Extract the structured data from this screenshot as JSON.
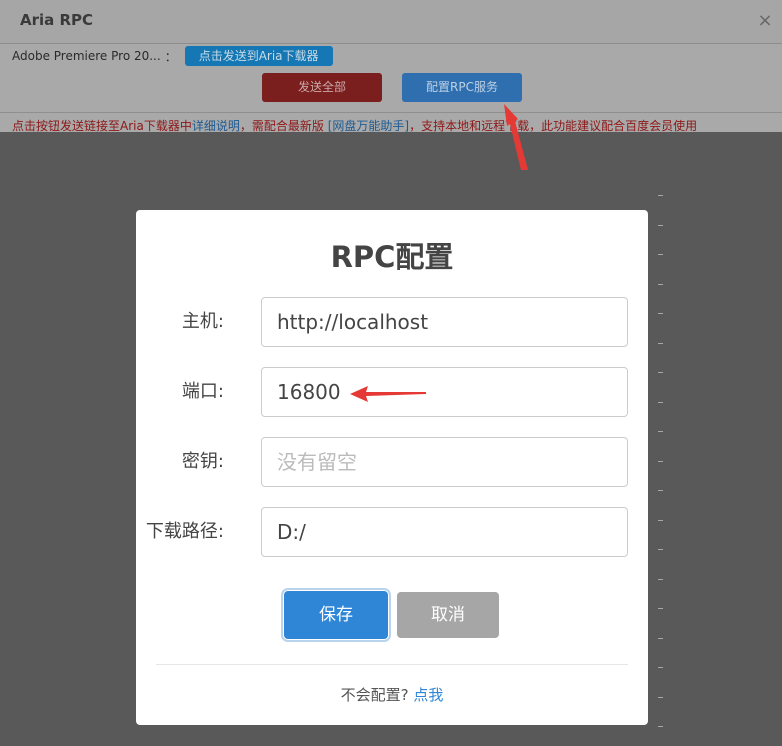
{
  "window": {
    "title": "Aria RPC",
    "close_glyph": "×"
  },
  "file_row": {
    "file_name": "Adobe Premiere Pro 20...",
    "separator": "：",
    "send_button": "点击发送到Aria下载器"
  },
  "actions": {
    "send_all": "发送全部",
    "config_rpc": "配置RPC服务"
  },
  "notice": {
    "part1": "点击按钮发送链接至Aria下载器中",
    "link1": "详细说明",
    "part2": "，需配合最新版 ",
    "link2": "[网盘万能助手]",
    "part3": "，支持本地和远程下载，此功能建议配合百度会员使用"
  },
  "dialog": {
    "title": "RPC配置",
    "fields": [
      {
        "label": "主机:",
        "value": "http://localhost",
        "placeholder": ""
      },
      {
        "label": "端口:",
        "value": "16800",
        "placeholder": ""
      },
      {
        "label": "密钥:",
        "value": "",
        "placeholder": "没有留空"
      },
      {
        "label": "下载路径:",
        "value": "D:/",
        "placeholder": ""
      }
    ],
    "save": "保存",
    "cancel": "取消",
    "help_text": "不会配置?",
    "help_link": "点我"
  },
  "colors": {
    "accent_blue": "#2f86d6",
    "annotation_red": "#e53935",
    "danger_red": "#7b1e1e"
  }
}
